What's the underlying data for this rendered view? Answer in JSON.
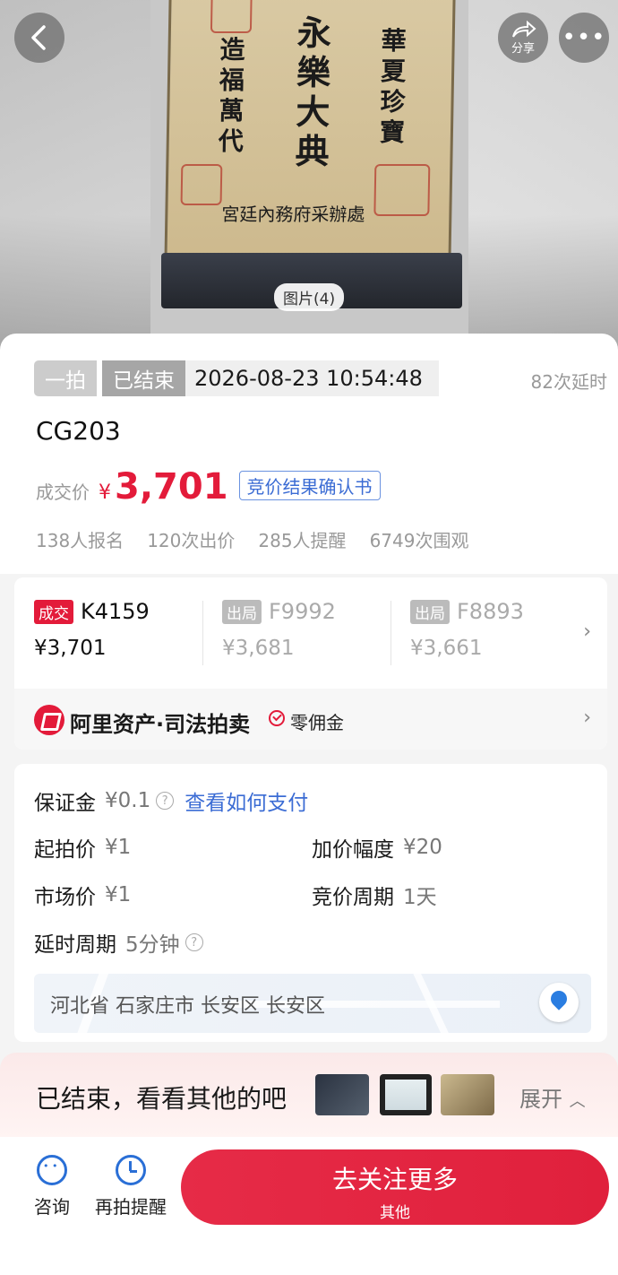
{
  "hero": {
    "image_tag": "图片(4)",
    "share_label": "分享",
    "back_icon": "chevron-left-icon",
    "share_icon": "share-arrow-icon",
    "more_icon": "more-dots-icon",
    "photo_text": {
      "center": "永樂大典",
      "left": "造福萬代",
      "right": "華夏珍寶",
      "bottom": "宮廷內務府采辦處"
    }
  },
  "status": {
    "type_label": "一拍",
    "state_label": "已结束",
    "end_time": "2026-08-23 10:54:48",
    "extend_count": "82次延时"
  },
  "lot": {
    "name": "CG203",
    "price_label": "成交价",
    "currency": "¥",
    "price": "3,701",
    "confirm_link": "竞价结果确认书"
  },
  "stats": {
    "signups": "138人报名",
    "bids": "120次出价",
    "reminders": "285人提醒",
    "views": "6749次围观"
  },
  "bids": [
    {
      "status": "成交",
      "code": "K4159",
      "amount": "¥3,701"
    },
    {
      "status": "出局",
      "code": "F9992",
      "amount": "¥3,681"
    },
    {
      "status": "出局",
      "code": "F8893",
      "amount": "¥3,661"
    }
  ],
  "brand": {
    "name": "阿里资产·司法拍卖",
    "note": "零佣金"
  },
  "details": {
    "deposit_label": "保证金",
    "deposit_value": "¥0.1",
    "pay_link": "查看如何支付",
    "start_price_label": "起拍价",
    "start_price_value": "¥1",
    "increment_label": "加价幅度",
    "increment_value": "¥20",
    "market_price_label": "市场价",
    "market_price_value": "¥1",
    "cycle_label": "竞价周期",
    "cycle_value": "1天",
    "delay_label": "延时周期",
    "delay_value": "5分钟",
    "location": "河北省 石家庄市 长安区 长安区"
  },
  "ended": {
    "text": "已结束，看看其他的吧",
    "expand_label": "展开"
  },
  "bottom": {
    "consult_label": "咨询",
    "remind_label": "再拍提醒",
    "cta_main": "去关注更多",
    "cta_sub": "其他"
  },
  "colors": {
    "accent_red": "#e31b3a",
    "link_blue": "#3b6cd4",
    "icon_blue": "#2a6fd6"
  }
}
